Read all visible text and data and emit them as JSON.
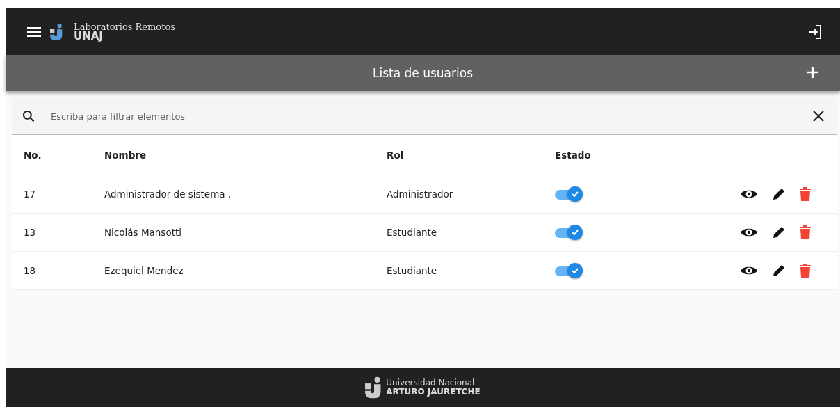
{
  "header": {
    "app_name": "Laboratorios Remotos",
    "brand": "UNAJ"
  },
  "title_bar": {
    "title": "Lista de usuarios"
  },
  "search": {
    "placeholder": "Escriba para filtrar elementos"
  },
  "table": {
    "columns": [
      "No.",
      "Nombre",
      "Rol",
      "Estado"
    ],
    "rows": [
      {
        "no": "17",
        "name": "Administrador de sistema .",
        "role": "Administrador",
        "active": true
      },
      {
        "no": "13",
        "name": "Nicolás Mansotti",
        "role": "Estudiante",
        "active": true
      },
      {
        "no": "18",
        "name": "Ezequiel Mendez",
        "role": "Estudiante",
        "active": true
      }
    ]
  },
  "footer": {
    "line1": "Universidad Nacional",
    "line2": "ARTURO JAURETCHE"
  }
}
